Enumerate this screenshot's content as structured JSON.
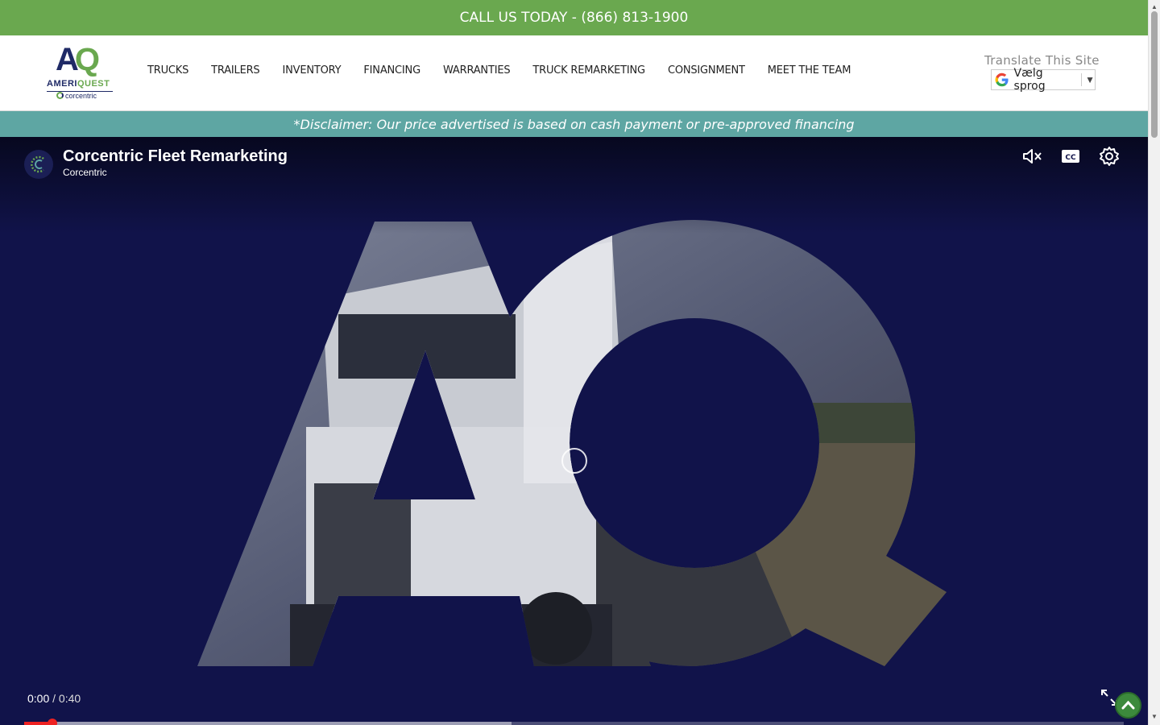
{
  "topbar": {
    "call_text": "CALL US TODAY - (866) 813-1900"
  },
  "logo": {
    "mark_a": "A",
    "mark_q": "Q",
    "brand_ameri": "AMERI",
    "brand_quest": "QUEST",
    "sub": "corcentric"
  },
  "nav": {
    "items": [
      {
        "label": "TRUCKS"
      },
      {
        "label": "TRAILERS"
      },
      {
        "label": "INVENTORY"
      },
      {
        "label": "FINANCING"
      },
      {
        "label": "WARRANTIES"
      },
      {
        "label": "TRUCK REMARKETING"
      },
      {
        "label": "CONSIGNMENT"
      },
      {
        "label": "MEET THE TEAM"
      }
    ]
  },
  "translate": {
    "label": "Translate This Site",
    "selected": "Vælg sprog",
    "arrow": "▼"
  },
  "disclaimer": {
    "text": "*Disclaimer: Our price advertised is based on cash payment or pre-approved financing"
  },
  "video": {
    "title": "Corcentric Fleet Remarketing",
    "channel": "Corcentric",
    "time_current": "0:00",
    "time_separator": " / ",
    "time_duration": "0:40",
    "played_fraction": 0.026,
    "buffered_fraction": 0.443
  },
  "colors": {
    "green": "#6aa84f",
    "navy": "#1f2a66",
    "teal": "#5ea6a3",
    "video_bg": "#11134a",
    "progress_red": "#e22"
  }
}
